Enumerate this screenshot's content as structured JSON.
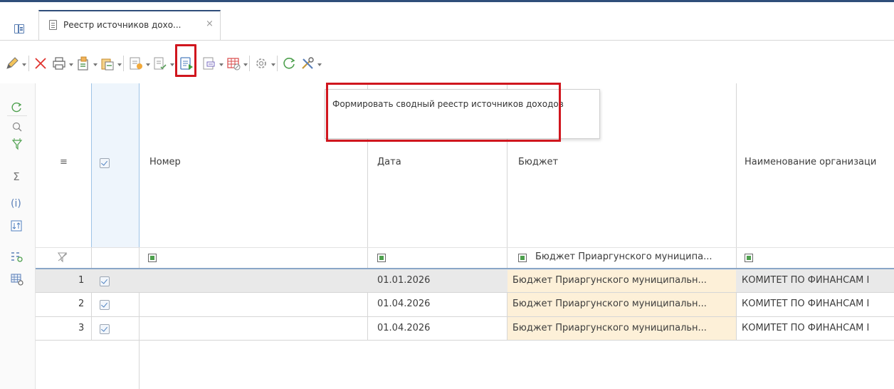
{
  "tab": {
    "label": "Реестр источников дохо...",
    "close": "×"
  },
  "tooltip": {
    "text": "Формировать сводный реестр источников доходов"
  },
  "columns": {
    "menu": "≡",
    "number": "Номер",
    "date": "Дата",
    "budget": "Бюджет",
    "org": "Наименование организаци"
  },
  "filter": {
    "budget": "Бюджет Приаргунского муниципа..."
  },
  "rows": [
    {
      "n": "1",
      "date": "01.01.2026",
      "budget": "Бюджет Приаргунского муниципальн...",
      "org": "КОМИТЕТ ПО ФИНАНСАМ І"
    },
    {
      "n": "2",
      "date": "01.04.2026",
      "budget": "Бюджет Приаргунского муниципальн...",
      "org": "КОМИТЕТ ПО ФИНАНСАМ І"
    },
    {
      "n": "3",
      "date": "01.04.2026",
      "budget": "Бюджет Приаргунского муниципальн...",
      "org": "КОМИТЕТ ПО ФИНАНСАМ І"
    }
  ],
  "colors": {
    "accent": "#2f4e7a",
    "highlight": "#d0161e",
    "budget_bg": "#fdf0d8"
  }
}
